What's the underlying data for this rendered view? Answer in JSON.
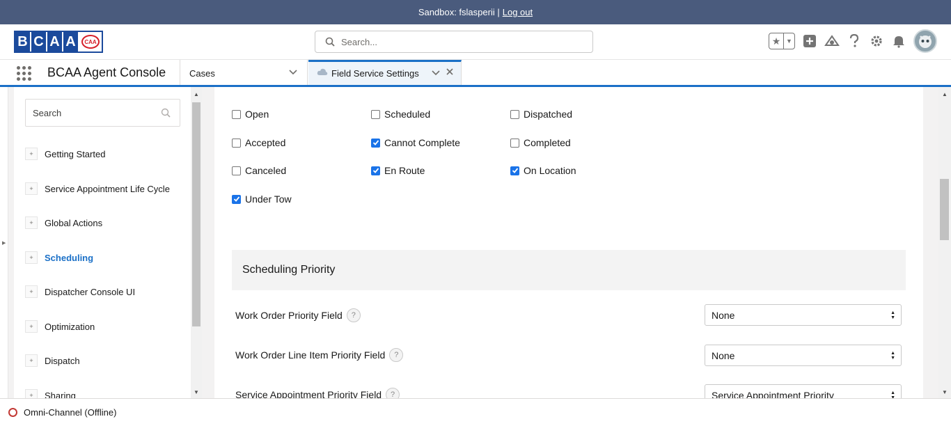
{
  "sandbox": {
    "label": "Sandbox: fslasperii |",
    "logout": "Log out"
  },
  "header": {
    "logo_letters": [
      "B",
      "C",
      "A",
      "A"
    ],
    "logo_badge": "CAA",
    "search_placeholder": "Search...",
    "icons": [
      "favorites-star-icon",
      "add-icon",
      "trailhead-icon",
      "help-icon",
      "setup-gear-icon",
      "notifications-bell-icon"
    ]
  },
  "nav": {
    "app_name": "BCAA Agent Console",
    "cases_label": "Cases",
    "tab_label": "Field Service Settings"
  },
  "sidebar": {
    "search_placeholder": "Search",
    "items": [
      {
        "label": "Getting Started"
      },
      {
        "label": "Service Appointment Life Cycle"
      },
      {
        "label": "Global Actions"
      },
      {
        "label": "Scheduling"
      },
      {
        "label": "Dispatcher Console UI"
      },
      {
        "label": "Optimization"
      },
      {
        "label": "Dispatch"
      },
      {
        "label": "Sharing"
      }
    ],
    "active_item": "Scheduling"
  },
  "statuses": [
    {
      "label": "Open",
      "checked": false
    },
    {
      "label": "Scheduled",
      "checked": false
    },
    {
      "label": "Dispatched",
      "checked": false
    },
    {
      "label": "Accepted",
      "checked": false
    },
    {
      "label": "Cannot Complete",
      "checked": true
    },
    {
      "label": "Completed",
      "checked": false
    },
    {
      "label": "Canceled",
      "checked": false
    },
    {
      "label": "En Route",
      "checked": true
    },
    {
      "label": "On Location",
      "checked": true
    },
    {
      "label": "Under Tow",
      "checked": true
    }
  ],
  "scheduling_priority": {
    "title": "Scheduling Priority",
    "fields": [
      {
        "label": "Work Order Priority Field",
        "value": "None"
      },
      {
        "label": "Work Order Line Item Priority Field",
        "value": "None"
      },
      {
        "label": "Service Appointment Priority Field",
        "value": "Service Appointment Priority"
      }
    ]
  },
  "footer": {
    "omni_channel": "Omni-Channel (Offline)"
  }
}
